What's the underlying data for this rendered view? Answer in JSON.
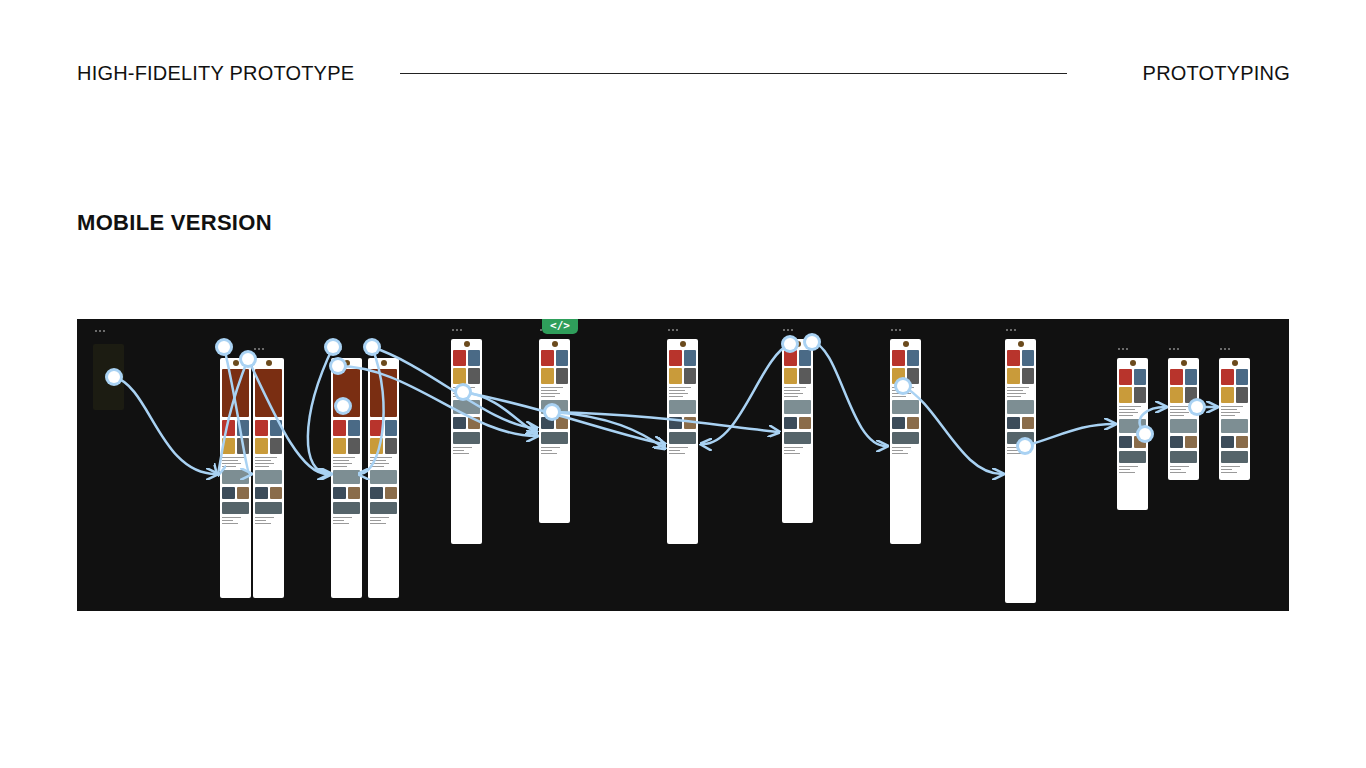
{
  "slide": {
    "header": {
      "title": "HIGH-FIDELITY PROTOTYPE",
      "section": "PROTOTYPING"
    },
    "heading": "MOBILE VERSION"
  },
  "prototype": {
    "badge": "</>"
  }
}
